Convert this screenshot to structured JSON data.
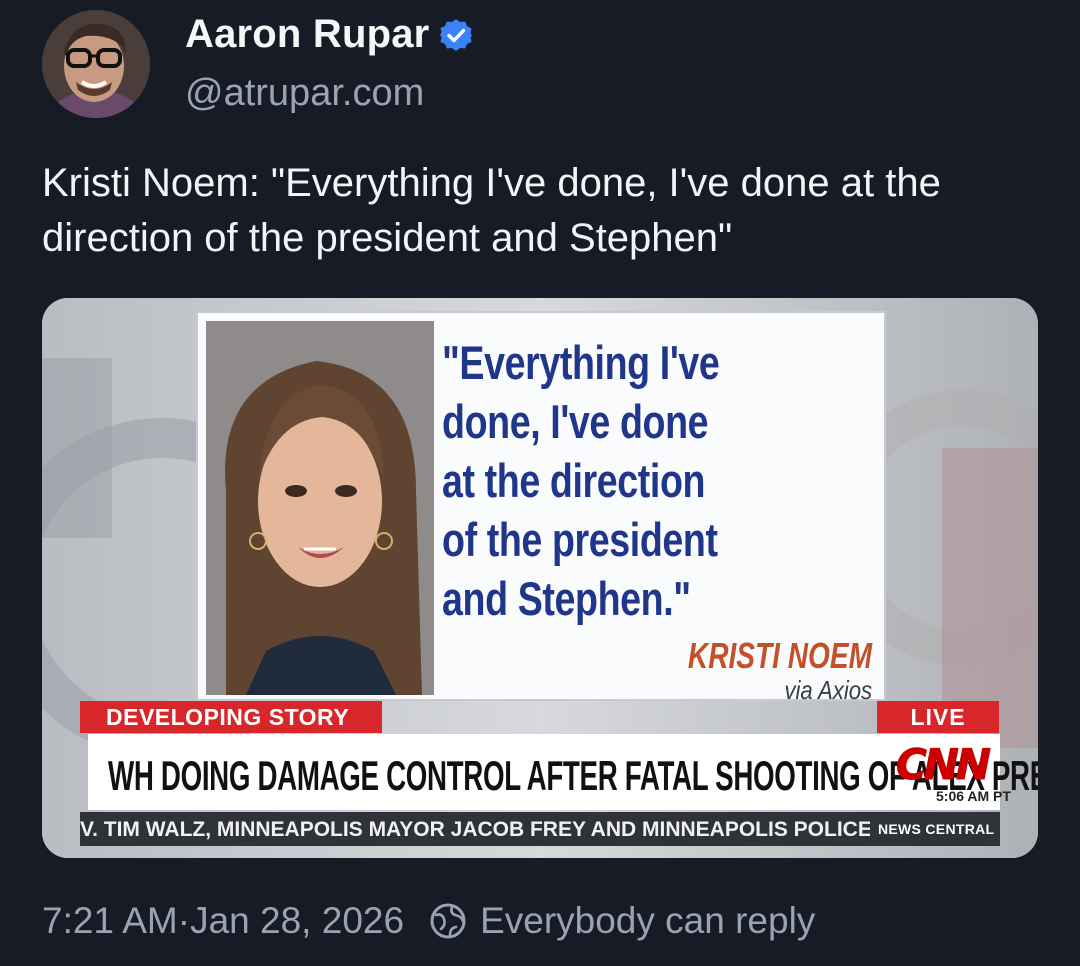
{
  "author": {
    "name": "Aaron Rupar",
    "handle": "@atrupar.com",
    "verified_icon": "verified-check-icon",
    "avatar_icon": "user-avatar"
  },
  "post": {
    "text": "Kristi Noem: \"Everything I've done, I've done at the direction of the president and Stephen\""
  },
  "media": {
    "quote": "\"Everything I've\ndone, I've done\nat the direction\nof the president\nand Stephen.\"",
    "attribution_name": "KRISTI NOEM",
    "attribution_source": "via Axios",
    "developing_label": "DEVELOPING STORY",
    "live_label": "LIVE",
    "headline": "WH DOING DAMAGE CONTROL AFTER FATAL SHOOTING OF ALEX PRETTI",
    "network_logo": "CNN",
    "time": "5:06 AM PT",
    "ticker": "V. TIM WALZ, MINNEAPOLIS MAYOR JACOB FREY AND MINNEAPOLIS POLICE CHIEF BRI",
    "ticker_source": "NEWS CENTRAL"
  },
  "footer": {
    "time": "7:21 AM",
    "separator": " · ",
    "date": "Jan 28, 2026",
    "reply_icon": "globe-reply-icon",
    "reply_setting": "Everybody can reply"
  },
  "colors": {
    "background": "#161b26",
    "verified": "#3b82f6",
    "secondary_text": "#9aa3b2",
    "cnn_red": "#d8272b",
    "quote_blue": "#20368a",
    "attribution_orange": "#c2512a"
  }
}
